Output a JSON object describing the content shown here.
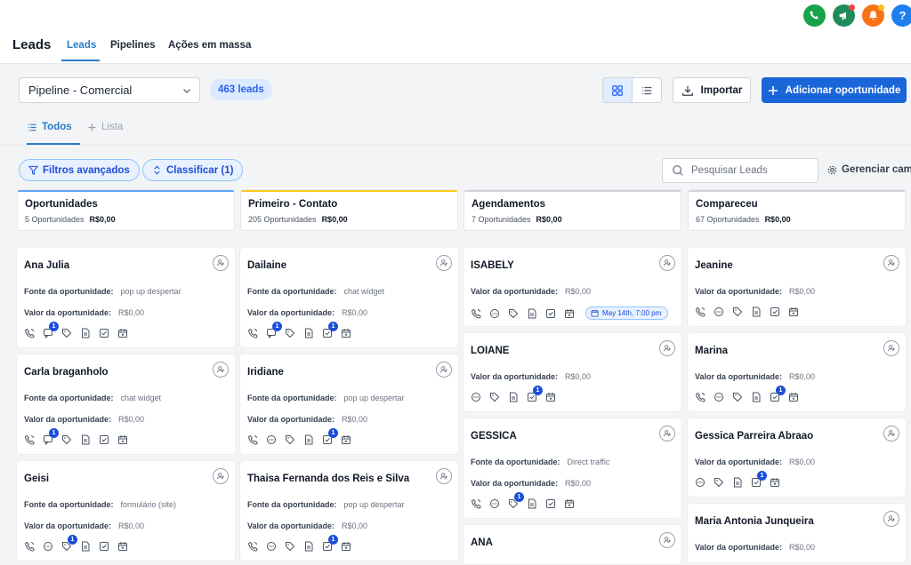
{
  "header": {
    "title": "Leads",
    "tabs": [
      {
        "label": "Leads",
        "active": true
      },
      {
        "label": "Pipelines",
        "active": false
      },
      {
        "label": "Ações em massa",
        "active": false
      }
    ],
    "help_label": "?"
  },
  "toolbar": {
    "pipeline_value": "Pipeline - Comercial",
    "lead_count": "463 leads",
    "import_label": "Importar",
    "add_label": "Adicionar oportunidade"
  },
  "subtabs": {
    "all_label": "Todos",
    "list_label": "Lista"
  },
  "filters": {
    "advanced_label": "Filtros avançados",
    "sort_label": "Classificar (1)",
    "search_placeholder": "Pesquisar Leads",
    "manage_label": "Gerenciar cam"
  },
  "labels": {
    "source": "Fonte da oportunidade:",
    "value": "Valor da oportunidade:"
  },
  "colors": {
    "primary": "#1a66d9",
    "tab_active": "#2b7cc4",
    "phone_icon_bg": "#16a34a",
    "announce_icon_bg": "#1f8a5a",
    "bell_icon_bg": "#f97316",
    "help_icon_bg": "#1d7ff0"
  },
  "columns": [
    {
      "name": "Oportunidades",
      "count": "5 Oportunidades",
      "total": "R$0,00",
      "accent": "#60a5fa",
      "cards": [
        {
          "name": "Ana Julia",
          "source": "pop up despertar",
          "value": "R$0,00",
          "icons": [
            "phone-icon",
            "chat-icon",
            "tag-icon",
            "note-icon",
            "task-icon",
            "calendar-icon"
          ],
          "badges": {
            "chat-icon": "1"
          }
        },
        {
          "name": "Carla braganholo",
          "source": "chat widget",
          "value": "R$0,00",
          "icons": [
            "phone-icon",
            "chat-icon",
            "tag-icon",
            "note-icon",
            "task-icon",
            "calendar-icon"
          ],
          "badges": {
            "chat-icon": "1"
          }
        },
        {
          "name": "Geisi",
          "source": "formulário (site)",
          "value": "R$0,00",
          "icons": [
            "phone-icon",
            "message-icon",
            "tag-icon",
            "note-icon",
            "task-icon",
            "calendar-icon"
          ],
          "badges": {
            "tag-icon": "1"
          }
        }
      ]
    },
    {
      "name": "Primeiro - Contato",
      "count": "205 Oportunidades",
      "total": "R$0,00",
      "accent": "#facc15",
      "cards": [
        {
          "name": "Dailaine",
          "source": "chat widget",
          "value": "R$0,00",
          "icons": [
            "phone-icon",
            "chat-icon",
            "tag-icon",
            "note-icon",
            "task-icon",
            "calendar-icon"
          ],
          "badges": {
            "chat-icon": "1",
            "task-icon": "1"
          }
        },
        {
          "name": "Iridiane",
          "source": "pop up despertar",
          "value": "R$0,00",
          "icons": [
            "phone-icon",
            "message-icon",
            "tag-icon",
            "note-icon",
            "task-icon",
            "calendar-icon"
          ],
          "badges": {
            "task-icon": "1"
          }
        },
        {
          "name": "Thaisa Fernanda dos Reis e Silva",
          "source": "pop up despertar",
          "value": "R$0,00",
          "icons": [
            "phone-icon",
            "message-icon",
            "tag-icon",
            "note-icon",
            "task-icon",
            "calendar-icon"
          ],
          "badges": {
            "task-icon": "1"
          }
        }
      ]
    },
    {
      "name": "Agendamentos",
      "count": "7 Oportunidades",
      "total": "R$0,00",
      "accent": "#d1d5db",
      "cards": [
        {
          "name": "ISABELY",
          "value": "R$0,00",
          "icons": [
            "phone-icon",
            "message-icon",
            "tag-icon",
            "note-icon",
            "task-icon",
            "calendar-icon"
          ],
          "badges": {},
          "appointment": "May 14th, 7:00 pm"
        },
        {
          "name": "LOIANE",
          "value": "R$0,00",
          "icons": [
            "message-icon",
            "tag-icon",
            "note-icon",
            "task-icon",
            "calendar-icon"
          ],
          "badges": {
            "task-icon": "1"
          }
        },
        {
          "name": "GESSICA",
          "source": "Direct traffic",
          "value": "R$0,00",
          "icons": [
            "phone-icon",
            "message-icon",
            "tag-icon",
            "note-icon",
            "task-icon",
            "calendar-icon"
          ],
          "badges": {
            "tag-icon": "1"
          }
        },
        {
          "name": "ANA"
        }
      ]
    },
    {
      "name": "Compareceu",
      "count": "67 Oportunidades",
      "total": "R$0,00",
      "accent": "#d1d5db",
      "cards": [
        {
          "name": "Jeanine",
          "value": "R$0,00",
          "icons": [
            "phone-icon",
            "message-icon",
            "tag-icon",
            "note-icon",
            "task-icon",
            "calendar-icon"
          ],
          "badges": {}
        },
        {
          "name": "Marina",
          "value": "R$0,00",
          "icons": [
            "phone-icon",
            "message-icon",
            "tag-icon",
            "note-icon",
            "task-icon",
            "calendar-icon"
          ],
          "badges": {
            "task-icon": "1"
          }
        },
        {
          "name": "Gessica Parreira Abraao",
          "value": "R$0,00",
          "icons": [
            "message-icon",
            "tag-icon",
            "note-icon",
            "task-icon",
            "calendar-icon"
          ],
          "badges": {
            "task-icon": "1"
          }
        },
        {
          "name": "Maria Antonia Junqueira",
          "value": "R$0,00"
        }
      ]
    }
  ]
}
